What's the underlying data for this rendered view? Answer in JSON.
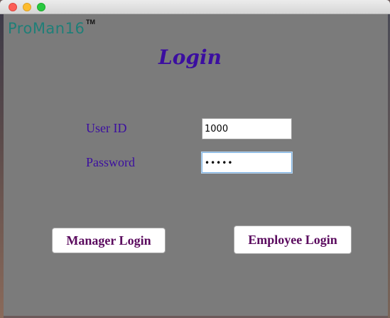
{
  "window": {
    "controls": [
      "close",
      "minimize",
      "maximize"
    ]
  },
  "app": {
    "logo_text": "ProMan16",
    "logo_trademark": "TM",
    "title": "Login"
  },
  "form": {
    "user_id_label": "User ID",
    "user_id_value": "1000",
    "password_label": "Password",
    "password_value": "•••••"
  },
  "buttons": {
    "manager_login": "Manager Login",
    "employee_login": "Employee Login"
  },
  "colors": {
    "logo": "#1f7f78",
    "title": "#3b0ea0",
    "labels": "#3b0ea0",
    "button_text": "#5a0a5e",
    "panel_background": "#7b7b7b"
  }
}
